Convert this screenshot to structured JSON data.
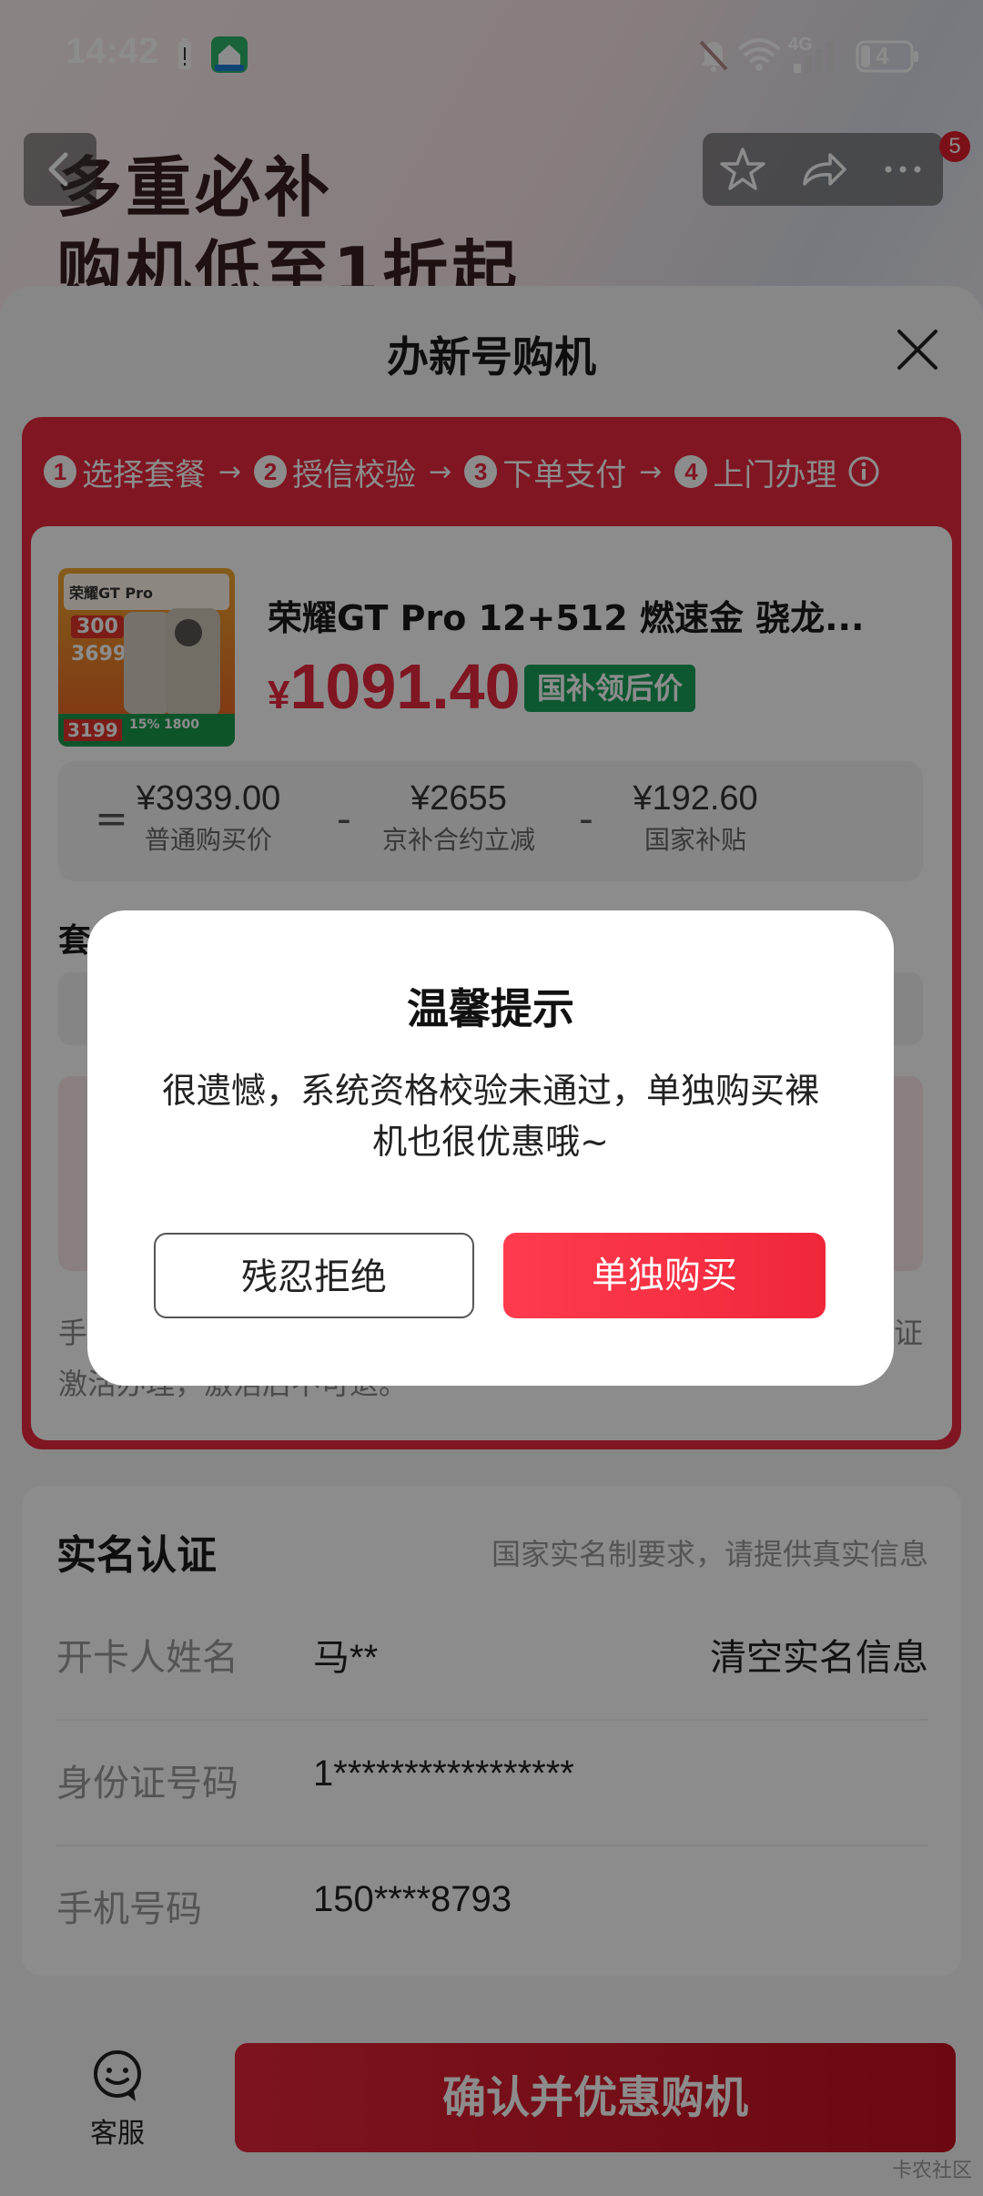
{
  "status_bar": {
    "time": "14:42",
    "network": "4G",
    "battery": "4",
    "icons": [
      "battery-warning-icon",
      "home-app-icon",
      "mute-bell-icon",
      "wifi-icon",
      "signal-icon",
      "battery-icon"
    ]
  },
  "hero": {
    "line1": "多重必补",
    "line2": "购机低至1折起"
  },
  "nav": {
    "badge_count": "5",
    "icons": [
      "back-icon",
      "star-icon",
      "share-icon",
      "more-icon"
    ]
  },
  "sheet": {
    "title": "办新号购机",
    "steps": [
      {
        "num": "1",
        "label": "选择套餐"
      },
      {
        "num": "2",
        "label": "授信校验"
      },
      {
        "num": "3",
        "label": "下单支付"
      },
      {
        "num": "4",
        "label": "上门办理"
      }
    ],
    "step_arrow": "→",
    "product": {
      "name": "荣耀GT Pro  12+512 燃速金 骁龙...",
      "currency": "¥",
      "price": "1091.40",
      "subsidy_tag": "国补领后价",
      "image_texts": [
        "荣耀GT Pro",
        "300",
        "3699",
        "3199",
        "15%",
        "1800"
      ]
    },
    "formula": {
      "equals": "=",
      "minus": "-",
      "items": [
        {
          "value": "¥3939.00",
          "label": "普通购买价"
        },
        {
          "value": "¥2655",
          "label": "京补合约立减"
        },
        {
          "value": "¥192.60",
          "label": "国家补贴"
        }
      ]
    },
    "partial_label": "套",
    "notice": {
      "line1_start": "手",
      "line1_end": "证",
      "line2": "激活办理，激活后不可退。"
    }
  },
  "realname": {
    "title": "实名认证",
    "hint": "国家实名制要求，请提供真实信息",
    "rows": [
      {
        "label": "开卡人姓名",
        "value": "马**",
        "action": "清空实名信息"
      },
      {
        "label": "身份证号码",
        "value": "1*****************"
      },
      {
        "label": "手机号码",
        "value": "150****8793"
      }
    ]
  },
  "bottom": {
    "service_label": "客服",
    "confirm_label": "确认并优惠购机",
    "watermark": "卡农社区"
  },
  "modal": {
    "title": "温馨提示",
    "message": "很遗憾，系统资格校验未通过，单独购买裸机也很优惠哦~",
    "reject_label": "残忍拒绝",
    "buy_label": "单独购买"
  },
  "colors": {
    "accent_red": "#e8293e",
    "subsidy_green": "#1aa05a",
    "overlay": "rgba(0,0,0,0.45)"
  }
}
